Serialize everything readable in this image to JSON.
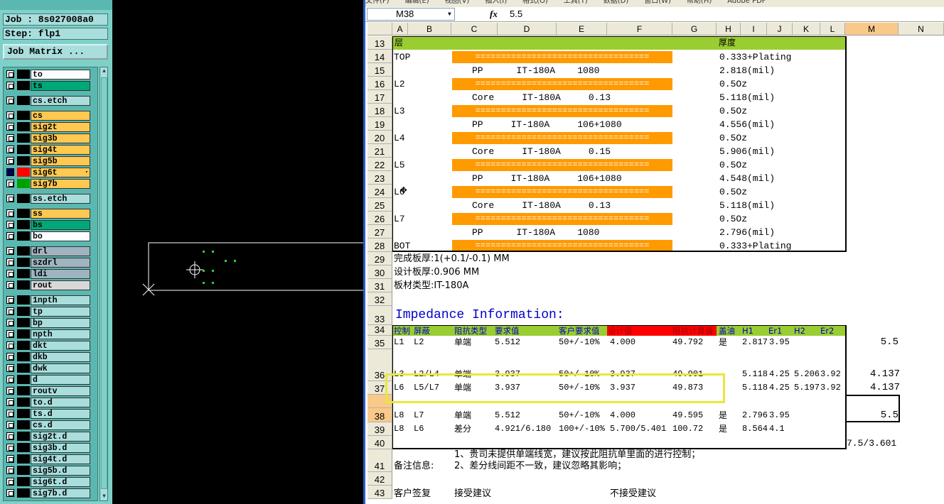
{
  "cam": {
    "job_label": "Job : 8s027008a0",
    "step_label": "Step: flp1",
    "matrix_button": "Job Matrix ...",
    "layers": [
      {
        "name": "to",
        "color": "#ffffff",
        "sw": "#000000"
      },
      {
        "name": "ts",
        "color": "#00a878",
        "sw": "#000000"
      },
      {
        "name": "cs.etch",
        "color": "#a9dedd",
        "sw": "#000000"
      },
      {
        "name": "cs",
        "color": "#ffc850",
        "sw": "#000000"
      },
      {
        "name": "sig2t",
        "color": "#ffc850",
        "sw": "#000000"
      },
      {
        "name": "sig3b",
        "color": "#ffc850",
        "sw": "#000000"
      },
      {
        "name": "sig4t",
        "color": "#ffc850",
        "sw": "#000000"
      },
      {
        "name": "sig5b",
        "color": "#ffc850",
        "sw": "#000000"
      },
      {
        "name": "sig6t",
        "color": "#ffc850",
        "sw": "#ff0000"
      },
      {
        "name": "sig7b",
        "color": "#ffc850",
        "sw": "#00a000"
      },
      {
        "name": "ss.etch",
        "color": "#a9dedd",
        "sw": "#000000"
      },
      {
        "name": "ss",
        "color": "#ffc850",
        "sw": "#000000"
      },
      {
        "name": "bs",
        "color": "#00a878",
        "sw": "#000000"
      },
      {
        "name": "bo",
        "color": "#ffffff",
        "sw": "#000000"
      },
      {
        "name": "drl",
        "color": "#9fb4c0",
        "sw": "#000000"
      },
      {
        "name": "szdrl",
        "color": "#9fb4c0",
        "sw": "#000000"
      },
      {
        "name": "ldi",
        "color": "#9fb4c0",
        "sw": "#000000"
      },
      {
        "name": "rout",
        "color": "#d8d8d8",
        "sw": "#000000"
      },
      {
        "name": "1npth",
        "color": "#a9dedd",
        "sw": "#000000"
      },
      {
        "name": "tp",
        "color": "#a9dedd",
        "sw": "#000000"
      },
      {
        "name": "bp",
        "color": "#a9dedd",
        "sw": "#000000"
      },
      {
        "name": "npth",
        "color": "#a9dedd",
        "sw": "#000000"
      },
      {
        "name": "dkt",
        "color": "#a9dedd",
        "sw": "#000000"
      },
      {
        "name": "dkb",
        "color": "#a9dedd",
        "sw": "#000000"
      },
      {
        "name": "dwk",
        "color": "#a9dedd",
        "sw": "#000000"
      },
      {
        "name": "d",
        "color": "#a9dedd",
        "sw": "#000000"
      },
      {
        "name": "routv",
        "color": "#a9dedd",
        "sw": "#000000"
      },
      {
        "name": "to.d",
        "color": "#a9dedd",
        "sw": "#000000"
      },
      {
        "name": "ts.d",
        "color": "#a9dedd",
        "sw": "#000000"
      },
      {
        "name": "cs.d",
        "color": "#a9dedd",
        "sw": "#000000"
      },
      {
        "name": "sig2t.d",
        "color": "#a9dedd",
        "sw": "#000000"
      },
      {
        "name": "sig3b.d",
        "color": "#a9dedd",
        "sw": "#000000"
      },
      {
        "name": "sig4t.d",
        "color": "#a9dedd",
        "sw": "#000000"
      },
      {
        "name": "sig5b.d",
        "color": "#a9dedd",
        "sw": "#000000"
      },
      {
        "name": "sig6t.d",
        "color": "#a9dedd",
        "sw": "#000000"
      },
      {
        "name": "sig7b.d",
        "color": "#a9dedd",
        "sw": "#000000"
      }
    ]
  },
  "excel": {
    "menu_items": [
      "文件(F)",
      "编辑(E)",
      "视图(V)",
      "插入(I)",
      "格式(O)",
      "工具(T)",
      "数据(D)",
      "窗口(W)",
      "帮助(H)",
      "Adobe PDF"
    ],
    "name_box": "M38",
    "fx": "fx",
    "formula_value": "5.5",
    "columns": [
      "A",
      "B",
      "C",
      "D",
      "E",
      "F",
      "G",
      "H",
      "I",
      "J",
      "K",
      "L",
      "M",
      "N"
    ],
    "rows": [
      "13",
      "14",
      "15",
      "16",
      "17",
      "18",
      "19",
      "20",
      "21",
      "22",
      "23",
      "24",
      "25",
      "26",
      "27",
      "28",
      "29",
      "30",
      "31",
      "32",
      "33",
      "34",
      "35",
      "36",
      "37",
      "",
      "38",
      "39",
      "40",
      "41",
      "42",
      "43"
    ],
    "stack_header": {
      "layer": "层",
      "thickness": "厚度"
    },
    "stack_rows": [
      {
        "layer": "TOP",
        "material": "",
        "thk": "0.333+Plating",
        "bar": true
      },
      {
        "layer": "",
        "material": "PP      IT-180A    1080",
        "thk": "2.818(mil)",
        "bar": false
      },
      {
        "layer": "L2",
        "material": "",
        "thk": "0.5Oz",
        "bar": true
      },
      {
        "layer": "",
        "material": "Core     IT-180A     0.13",
        "thk": "5.118(mil)",
        "bar": false
      },
      {
        "layer": "L3",
        "material": "",
        "thk": "0.5Oz",
        "bar": true
      },
      {
        "layer": "",
        "material": "PP     IT-180A     106+1080",
        "thk": "4.556(mil)",
        "bar": false
      },
      {
        "layer": "L4",
        "material": "",
        "thk": "0.5Oz",
        "bar": true
      },
      {
        "layer": "",
        "material": "Core     IT-180A     0.15",
        "thk": "5.906(mil)",
        "bar": false
      },
      {
        "layer": "L5",
        "material": "",
        "thk": "0.5Oz",
        "bar": true
      },
      {
        "layer": "",
        "material": "PP     IT-180A     106+1080",
        "thk": "4.548(mil)",
        "bar": false
      },
      {
        "layer": "L6",
        "material": "",
        "thk": "0.5Oz",
        "bar": true
      },
      {
        "layer": "",
        "material": "Core     IT-180A     0.13",
        "thk": "5.118(mil)",
        "bar": false
      },
      {
        "layer": "L7",
        "material": "",
        "thk": "0.5Oz",
        "bar": true
      },
      {
        "layer": "",
        "material": "PP      IT-180A    1080",
        "thk": "2.796(mil)",
        "bar": false
      },
      {
        "layer": "BOT",
        "material": "",
        "thk": "0.333+Plating",
        "bar": true
      }
    ],
    "bar_text": "==================================",
    "finished_thickness": "完成板厚:1(+0.1/-0.1) MM",
    "design_thickness": "设计板厚:0.906 MM",
    "material_type": "板材类型:IT-180A",
    "impedance_title": "Impedance Information:",
    "imp_headers": [
      "控制",
      "屏蔽",
      "阻抗类型",
      "要求值",
      "客户要求值",
      "设计值",
      "阻抗计算值",
      "盖油",
      "H1",
      "Er1",
      "H2",
      "Er2"
    ],
    "imp_rows": [
      [
        "L1",
        "L2",
        "单端",
        "5.512",
        "50+/-10%",
        "4.000",
        "49.792",
        "是",
        "2.817",
        "3.95",
        "",
        "",
        "5.5"
      ],
      [
        "L3",
        "L2/L4",
        "单端",
        "3.937",
        "50+/-10%",
        "3.937",
        "49.901",
        "",
        "5.118",
        "4.25",
        "5.206",
        "3.92",
        "4.137"
      ],
      [
        "L6",
        "L5/L7",
        "单端",
        "3.937",
        "50+/-10%",
        "3.937",
        "49.873",
        "",
        "5.118",
        "4.25",
        "5.197",
        "3.92",
        "4.137"
      ],
      [
        "L8",
        "L7",
        "单端",
        "5.512",
        "50+/-10%",
        "4.000",
        "49.595",
        "是",
        "2.796",
        "3.95",
        "",
        "",
        "5.5"
      ],
      [
        "L8",
        "L6",
        "差分",
        "4.921/6.180",
        "100+/-10%",
        "5.700/5.401",
        "100.72",
        "是",
        "8.564",
        "4.1",
        "",
        "",
        ""
      ]
    ],
    "m40": "7.5/3.601",
    "note1": "1、贵司未提供单端线宽，建议按此阻抗单里面的进行控制；",
    "note_label": "备注信息:",
    "note2": "2、差分线间距不一致，建议忽略其影响；",
    "row43_a": "客户签复",
    "row43_c": "接受建议",
    "row43_f": "不接受建议"
  }
}
